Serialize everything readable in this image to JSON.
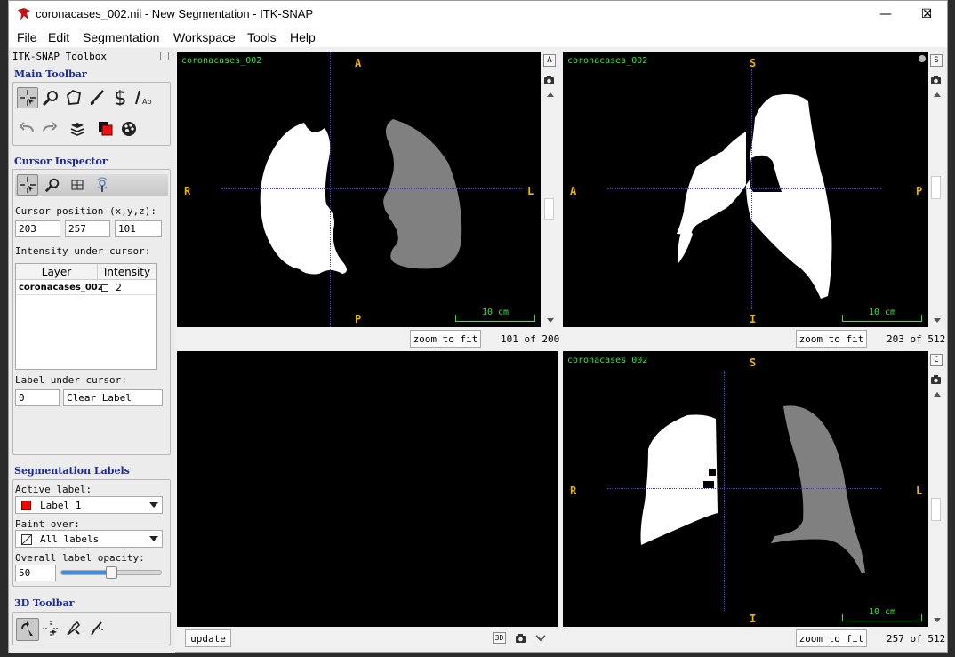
{
  "window": {
    "title": "coronacases_002.nii - New Segmentation - ITK-SNAP",
    "minimize": "—",
    "maximize": "☐",
    "close": "✕"
  },
  "menu": [
    "File",
    "Edit",
    "Segmentation",
    "Workspace",
    "Tools",
    "Help"
  ],
  "toolbox": {
    "title": "ITK-SNAP Toolbox",
    "main_toolbar_title": "Main Toolbar",
    "cursor_inspector_title": "Cursor Inspector",
    "cursor_position_label": "Cursor position (x,y,z):",
    "cursor_x": "203",
    "cursor_y": "257",
    "cursor_z": "101",
    "intensity_label": "Intensity under cursor:",
    "table_headers": [
      "Layer",
      "Intensity"
    ],
    "table_rows": [
      {
        "layer": "coronacases_002",
        "intensity": "2"
      }
    ],
    "label_under_cursor_label": "Label under cursor:",
    "label_under_cursor_value": "0",
    "label_under_cursor_name": "Clear Label",
    "seg_labels_title": "Segmentation Labels",
    "active_label_label": "Active label:",
    "active_label_value": "Label 1",
    "active_label_color": "#ff0000",
    "paint_over_label": "Paint over:",
    "paint_over_value": "All labels",
    "opacity_label": "Overall label opacity:",
    "opacity_value": "50",
    "toolbar_3d_title": "3D Toolbar"
  },
  "views": {
    "axial": {
      "name": "coronacases_002",
      "top": "A",
      "bottom": "P",
      "left": "R",
      "right": "L",
      "scale": "10 cm",
      "zoom": "zoom to fit",
      "slice": "101 of 200",
      "corner_btn": "A"
    },
    "sagittal": {
      "name": "coronacases_002",
      "top": "S",
      "bottom": "I",
      "left": "A",
      "right": "P",
      "scale": "10 cm",
      "zoom": "zoom to fit",
      "slice": "203 of 512",
      "corner_btn": "S"
    },
    "coronal": {
      "name": "coronacases_002",
      "top": "S",
      "bottom": "I",
      "left": "R",
      "right": "L",
      "scale": "10 cm",
      "zoom": "zoom to fit",
      "slice": "257 of 512",
      "corner_btn": "C"
    },
    "threed": {
      "update": "update",
      "btn_3d": "3D"
    }
  },
  "colors": {
    "crosshair": "#3a3aff",
    "orientation": "#f0b400",
    "overlay_text": "#39e639",
    "segment_gray": "#808080",
    "section_title": "#1a2a9a"
  }
}
